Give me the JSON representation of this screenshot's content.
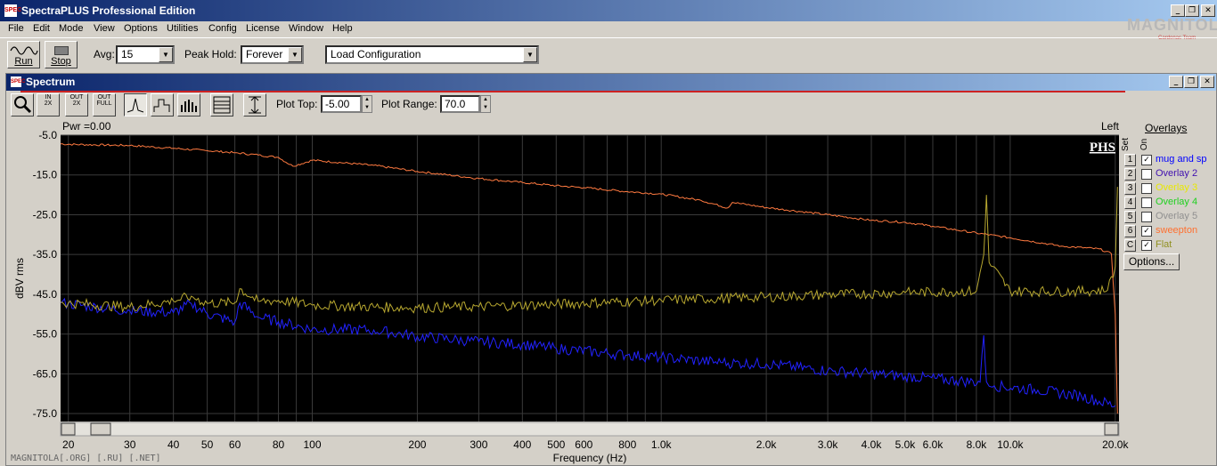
{
  "app": {
    "title": "SpectraPLUS Professional Edition",
    "icon": "app-icon"
  },
  "menu": [
    "File",
    "Edit",
    "Mode",
    "View",
    "Options",
    "Utilities",
    "Config",
    "License",
    "Window",
    "Help"
  ],
  "watermark": {
    "text": "MAGNITOLA",
    "sub": "Cardenas Team",
    "footer": "MAGNITOLA[.ORG] [.RU] [.NET]"
  },
  "toolbar": {
    "run_label": "Run",
    "stop_label": "Stop",
    "avg_label": "Avg:",
    "avg_value": "15",
    "peak_label": "Peak Hold:",
    "peak_value": "Forever",
    "config_value": "Load Configuration"
  },
  "spectrum": {
    "title": "Spectrum",
    "plot_top_label": "Plot Top:",
    "plot_top_value": "-5.00",
    "plot_range_label": "Plot Range:",
    "plot_range_value": "70.0",
    "pwr_text": "Pwr =0.00",
    "channel": "Left",
    "brand": "PHS"
  },
  "chart_data": {
    "type": "line",
    "xlabel": "Frequency (Hz)",
    "ylabel": "dBV rms",
    "xscale": "log",
    "xlim": [
      19,
      20500
    ],
    "ylim": [
      -77,
      -5
    ],
    "yticks": [
      "-5.0",
      "-15.0",
      "-25.0",
      "-35.0",
      "-45.0",
      "-55.0",
      "-65.0",
      "-75.0"
    ],
    "ytick_values": [
      -5,
      -15,
      -25,
      -35,
      -45,
      -55,
      -65,
      -75
    ],
    "xticks": [
      "20",
      "30",
      "40",
      "50",
      "60",
      "80",
      "100",
      "200",
      "300",
      "400",
      "500",
      "600",
      "800",
      "1.0k",
      "2.0k",
      "3.0k",
      "4.0k",
      "5.0k",
      "6.0k",
      "8.0k",
      "10.0k",
      "20.0k"
    ],
    "xtick_values": [
      20,
      30,
      40,
      50,
      60,
      80,
      100,
      200,
      300,
      400,
      500,
      600,
      800,
      1000,
      2000,
      3000,
      4000,
      5000,
      6000,
      8000,
      10000,
      20000
    ],
    "background": "#000000",
    "grid": true,
    "series": [
      {
        "name": "sweepton",
        "color": "#ff7a40",
        "x": [
          19,
          20,
          30,
          40,
          50,
          60,
          70,
          80,
          88,
          100,
          150,
          200,
          300,
          400,
          500,
          600,
          800,
          1000,
          1300,
          1550,
          1600,
          2000,
          3000,
          4000,
          5000,
          6000,
          8000,
          10000,
          14000,
          18000,
          19500,
          20000,
          20300
        ],
        "y": [
          -7.2,
          -7.3,
          -7.6,
          -8.3,
          -8.9,
          -9.4,
          -10,
          -10.6,
          -12.8,
          -11.3,
          -12.6,
          -14.1,
          -15.9,
          -16.9,
          -17.7,
          -18.2,
          -19.2,
          -19.8,
          -21.4,
          -23.3,
          -21.9,
          -23.2,
          -25.0,
          -26.4,
          -26.9,
          -27.9,
          -29.6,
          -30.8,
          -32.9,
          -33.6,
          -34.8,
          -50,
          -75
        ]
      },
      {
        "name": "mug and sp",
        "color": "#2222ff",
        "x": [
          19,
          20,
          30,
          40,
          45,
          50,
          60,
          62,
          70,
          80,
          100,
          150,
          200,
          300,
          400,
          500,
          800,
          1000,
          1500,
          2000,
          3000,
          5000,
          7000,
          8200,
          8400,
          8550,
          8700,
          9000,
          12000,
          16000,
          20000
        ],
        "y": [
          -47.2,
          -47.4,
          -49.2,
          -49.6,
          -47.3,
          -49.9,
          -52.0,
          -47.2,
          -50.8,
          -51.9,
          -53.8,
          -54.0,
          -55.6,
          -56.9,
          -57.6,
          -58.6,
          -60.3,
          -60.9,
          -62.2,
          -62.5,
          -64.2,
          -65.6,
          -66.7,
          -67.1,
          -55.3,
          -67.0,
          -68.1,
          -68.0,
          -69.1,
          -70.6,
          -73.0
        ]
      },
      {
        "name": "Flat",
        "color": "#b8a830",
        "x": [
          19,
          20,
          30,
          40,
          45,
          50,
          60,
          62,
          70,
          80,
          100,
          150,
          200,
          300,
          500,
          1000,
          2000,
          3000,
          5000,
          8000,
          8400,
          8550,
          8700,
          10000,
          15000,
          19000,
          20000,
          20300
        ],
        "y": [
          -47.0,
          -47.2,
          -48.2,
          -46.7,
          -45.5,
          -47.3,
          -47.1,
          -43.6,
          -46.8,
          -46.5,
          -47.7,
          -48.2,
          -48.4,
          -48.1,
          -47.5,
          -46.5,
          -45.7,
          -45.1,
          -44.6,
          -44.2,
          -35.0,
          -20.0,
          -37.0,
          -44.2,
          -44.3,
          -44.0,
          -38.0,
          -18.0
        ]
      }
    ]
  },
  "overlays": {
    "title": "Overlays",
    "set_label": "Set",
    "on_label": "On",
    "rows": [
      {
        "set": "1",
        "checked": "✓",
        "name": "mug and sp",
        "color": "#0000ff"
      },
      {
        "set": "2",
        "checked": "",
        "name": "Overlay 2",
        "color": "#4010b0"
      },
      {
        "set": "3",
        "checked": "",
        "name": "Overlay 3",
        "color": "#e8e800"
      },
      {
        "set": "4",
        "checked": "",
        "name": "Overlay 4",
        "color": "#20d020"
      },
      {
        "set": "5",
        "checked": "",
        "name": "Overlay 5",
        "color": "#909090"
      },
      {
        "set": "6",
        "checked": "✓",
        "name": "sweepton",
        "color": "#ff7030"
      },
      {
        "set": "C",
        "checked": "✓",
        "name": "Flat",
        "color": "#909020"
      }
    ],
    "options_label": "Options..."
  }
}
